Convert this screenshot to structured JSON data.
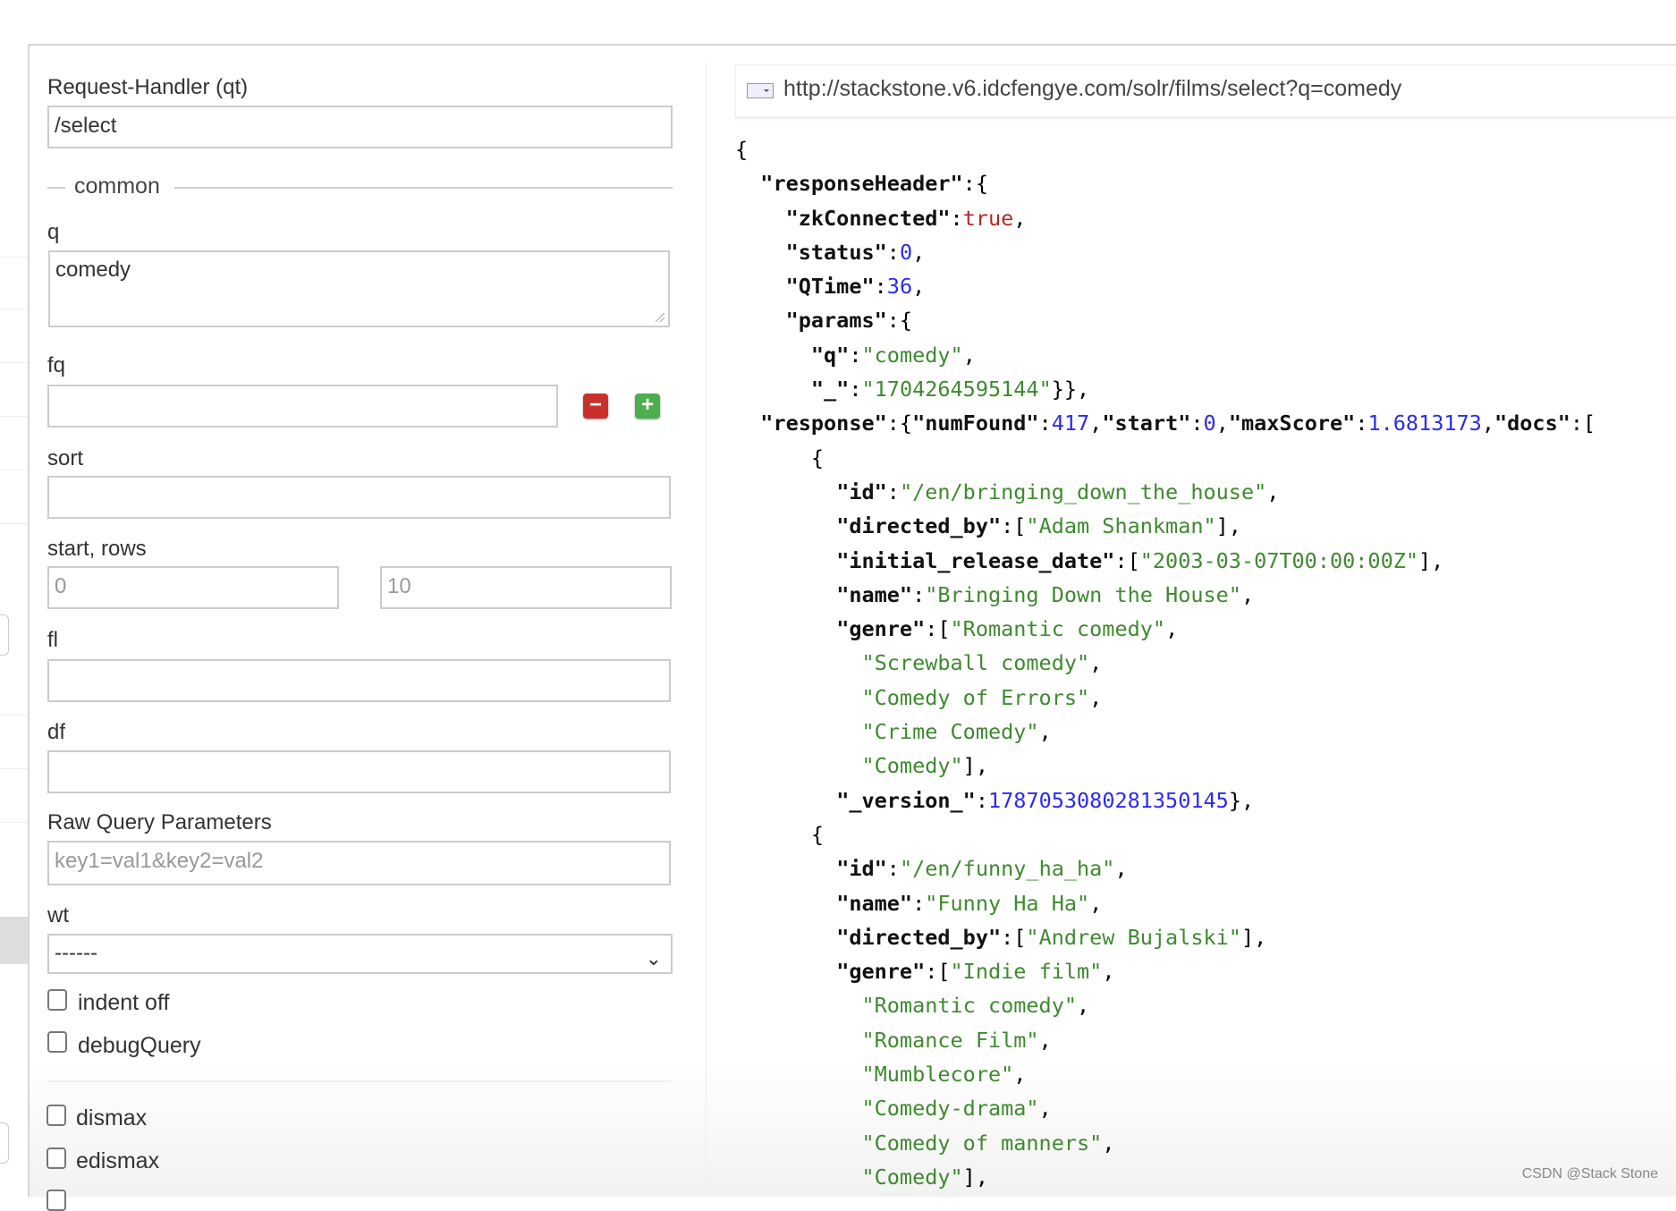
{
  "form": {
    "request_handler": {
      "label": "Request-Handler (qt)",
      "value": "/select"
    },
    "legend": "common",
    "q": {
      "label": "q",
      "value": "comedy"
    },
    "fq": {
      "label": "fq",
      "value": ""
    },
    "sort": {
      "label": "sort",
      "value": ""
    },
    "start_rows": {
      "label": "start, rows",
      "start_placeholder": "0",
      "rows_placeholder": "10"
    },
    "fl": {
      "label": "fl",
      "value": ""
    },
    "df": {
      "label": "df",
      "value": ""
    },
    "raw": {
      "label": "Raw Query Parameters",
      "placeholder": "key1=val1&key2=val2"
    },
    "wt": {
      "label": "wt",
      "selected": "------"
    },
    "checkboxes": [
      {
        "label": "indent off",
        "checked": false
      },
      {
        "label": "debugQuery",
        "checked": false
      },
      {
        "label": "dismax",
        "checked": false
      },
      {
        "label": "edismax",
        "checked": false
      }
    ],
    "buttons": {
      "remove": "−",
      "add": "+",
      "remove_color": "#c9302c",
      "add_color": "#4cae4c"
    }
  },
  "result": {
    "url": "http://stackstone.v6.idcfengye.com/solr/films/select?q=comedy",
    "lines": [
      [
        [
          "p",
          "{"
        ]
      ],
      [
        [
          "p",
          "  "
        ],
        [
          "k",
          "\"responseHeader\""
        ],
        [
          "p",
          ":{"
        ]
      ],
      [
        [
          "p",
          "    "
        ],
        [
          "k",
          "\"zkConnected\""
        ],
        [
          "p",
          ":"
        ],
        [
          "b",
          "true"
        ],
        [
          "p",
          ","
        ]
      ],
      [
        [
          "p",
          "    "
        ],
        [
          "k",
          "\"status\""
        ],
        [
          "p",
          ":"
        ],
        [
          "n",
          "0"
        ],
        [
          "p",
          ","
        ]
      ],
      [
        [
          "p",
          "    "
        ],
        [
          "k",
          "\"QTime\""
        ],
        [
          "p",
          ":"
        ],
        [
          "n",
          "36"
        ],
        [
          "p",
          ","
        ]
      ],
      [
        [
          "p",
          "    "
        ],
        [
          "k",
          "\"params\""
        ],
        [
          "p",
          ":{"
        ]
      ],
      [
        [
          "p",
          "      "
        ],
        [
          "k",
          "\"q\""
        ],
        [
          "p",
          ":"
        ],
        [
          "s",
          "\"comedy\""
        ],
        [
          "p",
          ","
        ]
      ],
      [
        [
          "p",
          "      "
        ],
        [
          "k",
          "\"_\""
        ],
        [
          "p",
          ":"
        ],
        [
          "s",
          "\"1704264595144\""
        ],
        [
          "p",
          "}},"
        ]
      ],
      [
        [
          "p",
          "  "
        ],
        [
          "k",
          "\"response\""
        ],
        [
          "p",
          ":{"
        ],
        [
          "k",
          "\"numFound\""
        ],
        [
          "p",
          ":"
        ],
        [
          "n",
          "417"
        ],
        [
          "p",
          ","
        ],
        [
          "k",
          "\"start\""
        ],
        [
          "p",
          ":"
        ],
        [
          "n",
          "0"
        ],
        [
          "p",
          ","
        ],
        [
          "k",
          "\"maxScore\""
        ],
        [
          "p",
          ":"
        ],
        [
          "n",
          "1.6813173"
        ],
        [
          "p",
          ","
        ],
        [
          "k",
          "\"docs\""
        ],
        [
          "p",
          ":["
        ]
      ],
      [
        [
          "p",
          "      {"
        ]
      ],
      [
        [
          "p",
          "        "
        ],
        [
          "k",
          "\"id\""
        ],
        [
          "p",
          ":"
        ],
        [
          "s",
          "\"/en/bringing_down_the_house\""
        ],
        [
          "p",
          ","
        ]
      ],
      [
        [
          "p",
          "        "
        ],
        [
          "k",
          "\"directed_by\""
        ],
        [
          "p",
          ":["
        ],
        [
          "s",
          "\"Adam Shankman\""
        ],
        [
          "p",
          "],"
        ]
      ],
      [
        [
          "p",
          "        "
        ],
        [
          "k",
          "\"initial_release_date\""
        ],
        [
          "p",
          ":["
        ],
        [
          "s",
          "\"2003-03-07T00:00:00Z\""
        ],
        [
          "p",
          "],"
        ]
      ],
      [
        [
          "p",
          "        "
        ],
        [
          "k",
          "\"name\""
        ],
        [
          "p",
          ":"
        ],
        [
          "s",
          "\"Bringing Down the House\""
        ],
        [
          "p",
          ","
        ]
      ],
      [
        [
          "p",
          "        "
        ],
        [
          "k",
          "\"genre\""
        ],
        [
          "p",
          ":["
        ],
        [
          "s",
          "\"Romantic comedy\""
        ],
        [
          "p",
          ","
        ]
      ],
      [
        [
          "p",
          "          "
        ],
        [
          "s",
          "\"Screwball comedy\""
        ],
        [
          "p",
          ","
        ]
      ],
      [
        [
          "p",
          "          "
        ],
        [
          "s",
          "\"Comedy of Errors\""
        ],
        [
          "p",
          ","
        ]
      ],
      [
        [
          "p",
          "          "
        ],
        [
          "s",
          "\"Crime Comedy\""
        ],
        [
          "p",
          ","
        ]
      ],
      [
        [
          "p",
          "          "
        ],
        [
          "s",
          "\"Comedy\""
        ],
        [
          "p",
          "],"
        ]
      ],
      [
        [
          "p",
          "        "
        ],
        [
          "k",
          "\"_version_\""
        ],
        [
          "p",
          ":"
        ],
        [
          "n",
          "1787053080281350145"
        ],
        [
          "p",
          "},"
        ]
      ],
      [
        [
          "p",
          "      {"
        ]
      ],
      [
        [
          "p",
          "        "
        ],
        [
          "k",
          "\"id\""
        ],
        [
          "p",
          ":"
        ],
        [
          "s",
          "\"/en/funny_ha_ha\""
        ],
        [
          "p",
          ","
        ]
      ],
      [
        [
          "p",
          "        "
        ],
        [
          "k",
          "\"name\""
        ],
        [
          "p",
          ":"
        ],
        [
          "s",
          "\"Funny Ha Ha\""
        ],
        [
          "p",
          ","
        ]
      ],
      [
        [
          "p",
          "        "
        ],
        [
          "k",
          "\"directed_by\""
        ],
        [
          "p",
          ":["
        ],
        [
          "s",
          "\"Andrew Bujalski\""
        ],
        [
          "p",
          "],"
        ]
      ],
      [
        [
          "p",
          "        "
        ],
        [
          "k",
          "\"genre\""
        ],
        [
          "p",
          ":["
        ],
        [
          "s",
          "\"Indie film\""
        ],
        [
          "p",
          ","
        ]
      ],
      [
        [
          "p",
          "          "
        ],
        [
          "s",
          "\"Romantic comedy\""
        ],
        [
          "p",
          ","
        ]
      ],
      [
        [
          "p",
          "          "
        ],
        [
          "s",
          "\"Romance Film\""
        ],
        [
          "p",
          ","
        ]
      ],
      [
        [
          "p",
          "          "
        ],
        [
          "s",
          "\"Mumblecore\""
        ],
        [
          "p",
          ","
        ]
      ],
      [
        [
          "p",
          "          "
        ],
        [
          "s",
          "\"Comedy-drama\""
        ],
        [
          "p",
          ","
        ]
      ],
      [
        [
          "p",
          "          "
        ],
        [
          "s",
          "\"Comedy of manners\""
        ],
        [
          "p",
          ","
        ]
      ],
      [
        [
          "p",
          "          "
        ],
        [
          "s",
          "\"Comedy\""
        ],
        [
          "p",
          "],"
        ]
      ]
    ]
  },
  "watermark": "CSDN @Stack Stone"
}
